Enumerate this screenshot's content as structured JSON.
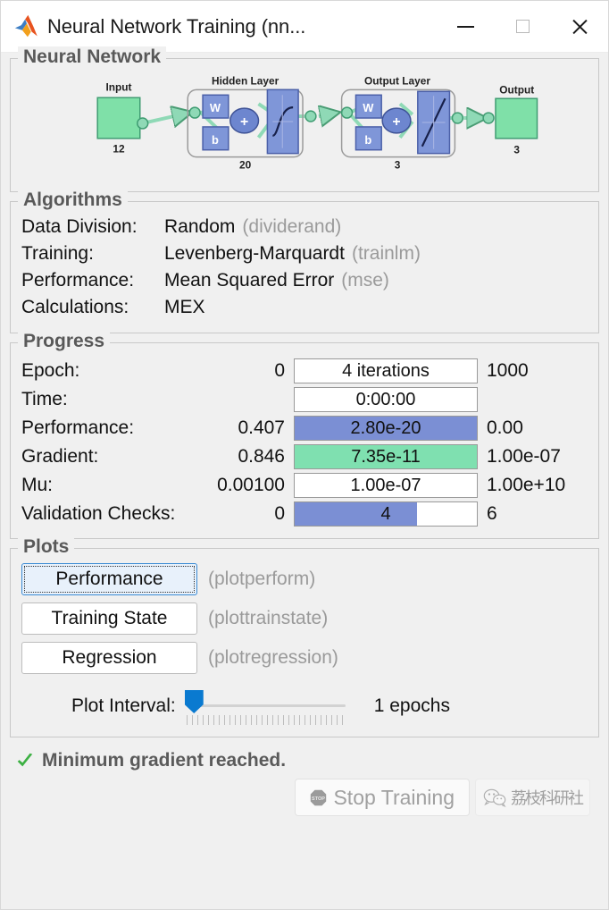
{
  "window": {
    "title": "Neural Network Training (nn...",
    "app_icon": "matlab-logo-icon",
    "minimize_label": "Minimize",
    "maximize_label": "Maximize",
    "close_label": "Close"
  },
  "neural_network": {
    "group_label": "Neural Network",
    "input_label": "Input",
    "input_size": "12",
    "hidden_layer_label": "Hidden Layer",
    "hidden_size": "20",
    "output_layer_label": "Output Layer",
    "output_layer_size": "3",
    "output_label": "Output",
    "output_size": "3",
    "weight_label": "W",
    "bias_label": "b",
    "sum_label": "+"
  },
  "algorithms": {
    "group_label": "Algorithms",
    "rows": [
      {
        "key": "Data Division:",
        "value": "Random",
        "fn": "(dividerand)"
      },
      {
        "key": "Training:",
        "value": "Levenberg-Marquardt",
        "fn": "(trainlm)"
      },
      {
        "key": "Performance:",
        "value": "Mean Squared Error",
        "fn": "(mse)"
      },
      {
        "key": "Calculations:",
        "value": "MEX",
        "fn": ""
      }
    ]
  },
  "progress": {
    "group_label": "Progress",
    "rows": [
      {
        "label": "Epoch:",
        "start": "0",
        "current": "4 iterations",
        "stop": "1000",
        "fill_pct": 0,
        "fill_color": "#ffffff"
      },
      {
        "label": "Time:",
        "start": "",
        "current": "0:00:00",
        "stop": "",
        "fill_pct": 0,
        "fill_color": "#ffffff"
      },
      {
        "label": "Performance:",
        "start": "0.407",
        "current": "2.80e-20",
        "stop": "0.00",
        "fill_pct": 100,
        "fill_color": "#7b8fd4"
      },
      {
        "label": "Gradient:",
        "start": "0.846",
        "current": "7.35e-11",
        "stop": "1.00e-07",
        "fill_pct": 100,
        "fill_color": "#7fe0b0"
      },
      {
        "label": "Mu:",
        "start": "0.00100",
        "current": "1.00e-07",
        "stop": "1.00e+10",
        "fill_pct": 0,
        "fill_color": "#ffffff"
      },
      {
        "label": "Validation Checks:",
        "start": "0",
        "current": "4",
        "stop": "6",
        "fill_pct": 67,
        "fill_color": "#7b8fd4"
      }
    ]
  },
  "plots": {
    "group_label": "Plots",
    "buttons": [
      {
        "label": "Performance",
        "fn": "(plotperform)",
        "focused": true
      },
      {
        "label": "Training State",
        "fn": "(plottrainstate)",
        "focused": false
      },
      {
        "label": "Regression",
        "fn": "(plotregression)",
        "focused": false
      }
    ],
    "interval_label": "Plot Interval:",
    "interval_value": "1 epochs",
    "interval_slider_pct": 0
  },
  "status": {
    "icon": "green-check-icon",
    "message": "Minimum gradient reached."
  },
  "footer": {
    "stop_button_label": "Stop Training",
    "stop_icon": "stop-sign-icon",
    "watermark_text": "荔枝科研社",
    "watermark_icon": "wechat-icon"
  },
  "colors": {
    "accent_blue": "#7b8fd4",
    "accent_green": "#7fe0b0",
    "node_green": "#7fe0a8",
    "node_blue": "#7f96d8",
    "slider_blue": "#0a7ad0",
    "check_green": "#3cb043"
  }
}
